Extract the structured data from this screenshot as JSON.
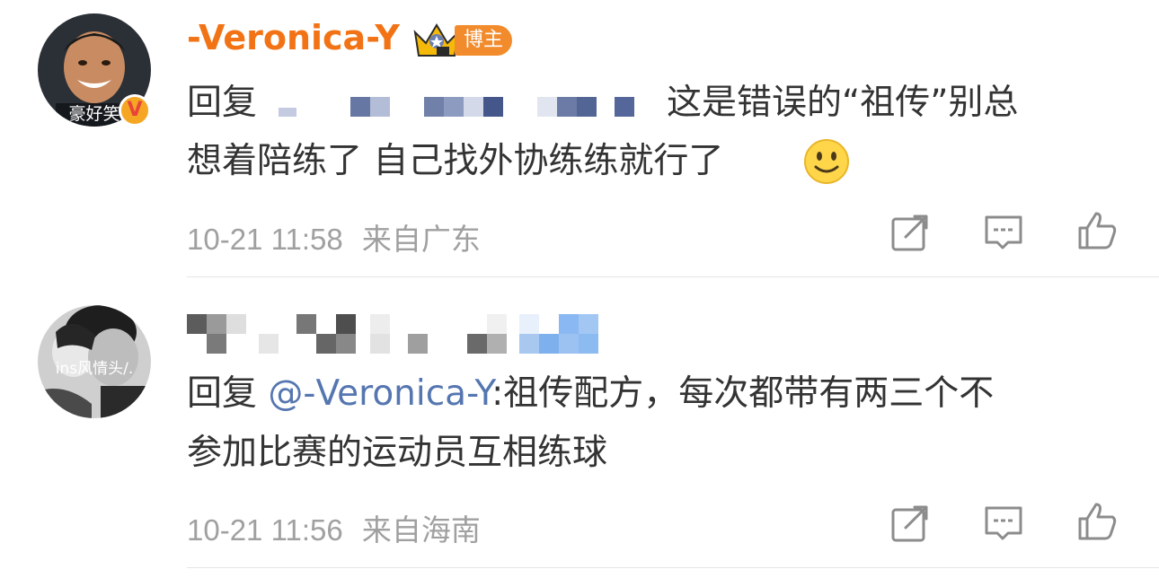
{
  "comments": [
    {
      "author": "-Veronica-Y",
      "avatar_caption": "豪好笑",
      "verified_mark": "V",
      "host_tag": "博主",
      "reply_prefix": "回复",
      "line1_text": "这是错误的“祖传”别总",
      "line2_text": "想着陪练了 自己找外协练练就行了",
      "emoji": "smile-emoji",
      "time": "10-21 11:58",
      "location": "来自广东",
      "actions": [
        "share-icon",
        "comment-icon",
        "like-icon"
      ]
    },
    {
      "author": "",
      "avatar_caption": "ins风情头/.",
      "reply_prefix": "回复",
      "mention": "@-Veronica-Y",
      "line1_text": ":祖传配方，每次都带有两三个不",
      "line2_text": "参加比赛的运动员互相练球",
      "time": "10-21 11:56",
      "location": "来自海南",
      "actions": [
        "share-icon",
        "comment-icon",
        "like-icon"
      ]
    }
  ],
  "colors": {
    "author": "#f27315",
    "mention": "#5576b0",
    "meta": "#a0a0a0",
    "host_tag": "#f28b2c"
  }
}
